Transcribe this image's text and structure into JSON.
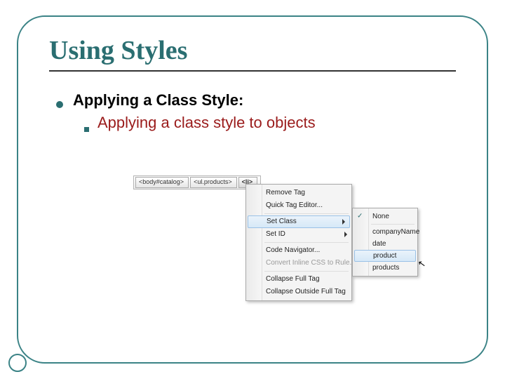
{
  "title": "Using Styles",
  "bullet1": "Applying a Class Style:",
  "bullet2": "Applying a class style to objects",
  "tag_selector": {
    "tags": [
      "<body#catalog>",
      "<ul.products>",
      "<li>"
    ]
  },
  "context_menu": {
    "items": [
      "Remove Tag",
      "Quick Tag Editor...",
      "Set Class",
      "Set ID",
      "Code Navigator...",
      "Convert Inline CSS to Rule...",
      "Collapse Full Tag",
      "Collapse Outside Full Tag"
    ]
  },
  "submenu": {
    "items": [
      "None",
      "companyName",
      "date",
      "product",
      "products"
    ]
  }
}
